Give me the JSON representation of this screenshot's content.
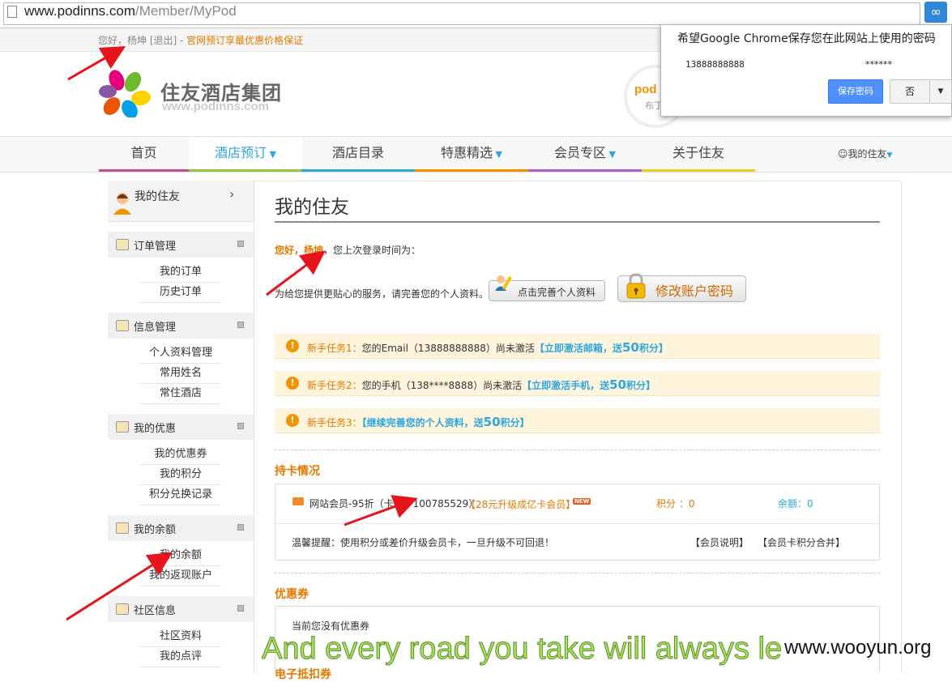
{
  "browser": {
    "url_host": "www.podinns.com",
    "url_path": "/Member/MyPod"
  },
  "password_popup": {
    "title": "希望Google Chrome保存您在此网站上使用的密码",
    "username": "13888888888",
    "password": "******",
    "save_label": "保存密码",
    "no_label": "否"
  },
  "topbar": {
    "greeting": "您好，杨坤 [退出]",
    "separator": " - ",
    "promo": "官网预订享最优惠价格保证"
  },
  "logo": {
    "name_cn": "住友酒店集团",
    "name_en": "www.podinns.com",
    "badge_text": "pod",
    "badge_sub": "布丁"
  },
  "nav": {
    "items": [
      {
        "label": "首页",
        "dropdown": false,
        "active": false
      },
      {
        "label": "酒店预订",
        "dropdown": true,
        "active": true
      },
      {
        "label": "酒店目录",
        "dropdown": false,
        "active": false
      },
      {
        "label": "特惠精选",
        "dropdown": true,
        "active": false
      },
      {
        "label": "会员专区",
        "dropdown": true,
        "active": false
      },
      {
        "label": "关于住友",
        "dropdown": false,
        "active": false
      }
    ],
    "user_label": "我的住友",
    "colors": [
      "#c0508f",
      "#9ac43d",
      "#2ea7e0",
      "#f39100",
      "#b05fc2",
      "#e6d21e"
    ]
  },
  "sidebar": {
    "top_label": "我的住友",
    "sections": [
      {
        "title": "订单管理",
        "links": [
          "我的订单",
          "历史订单"
        ]
      },
      {
        "title": "信息管理",
        "links": [
          "个人资料管理",
          "常用姓名",
          "常住酒店"
        ]
      },
      {
        "title": "我的优惠",
        "links": [
          "我的优惠券",
          "我的积分",
          "积分兑换记录"
        ]
      },
      {
        "title": "我的余额",
        "links": [
          "我的余额",
          "我的返现账户"
        ]
      },
      {
        "title": "社区信息",
        "links": [
          "社区资料",
          "我的点评"
        ]
      }
    ]
  },
  "main": {
    "title": "我的住友",
    "greeting_name": "您好，杨坤",
    "greeting_rest": "，您上次登录时间为：",
    "service_text": "为给您提供更贴心的服务，请完善您的个人资料。",
    "complete_button": "点击完善个人资料",
    "password_button": "修改账户密码",
    "tasks": [
      {
        "label": "新手任务1：",
        "text": "您的Email（13888888888）尚未激活",
        "link_pre": "【立即激活邮箱，送",
        "link_num": "50",
        "link_post": "积分】"
      },
      {
        "label": "新手任务2：",
        "text": "您的手机（138****8888）尚未激活",
        "link_pre": "【立即激活手机，送",
        "link_num": "50",
        "link_post": "积分】"
      },
      {
        "label": "新手任务3：",
        "text": "",
        "link_pre": "【继续完善您的个人资料，送",
        "link_num": "50",
        "link_post": "积分】"
      }
    ],
    "card_section": {
      "title": "持卡情况",
      "card_text": "网站会员-95折（卡号：100785529）",
      "upgrade_link": "【28元升级成亿卡会员】",
      "new_badge": "NEW",
      "points": "积分 ：0",
      "balance": "余额：0",
      "tip": "温馨提醒：使用积分或差价升级会员卡，一旦升级不可回退！",
      "link_explain": "【会员说明】",
      "link_merge": "【会员卡积分合并】"
    },
    "coupon_section": {
      "title": "优惠券",
      "empty_text": "当前您没有优惠券"
    },
    "next_section_title": "电子抵扣券"
  },
  "overlays": {
    "caption": "And every road you take will always le",
    "watermark": "www.wooyun.org",
    "arrow_color": "#e8141b"
  }
}
